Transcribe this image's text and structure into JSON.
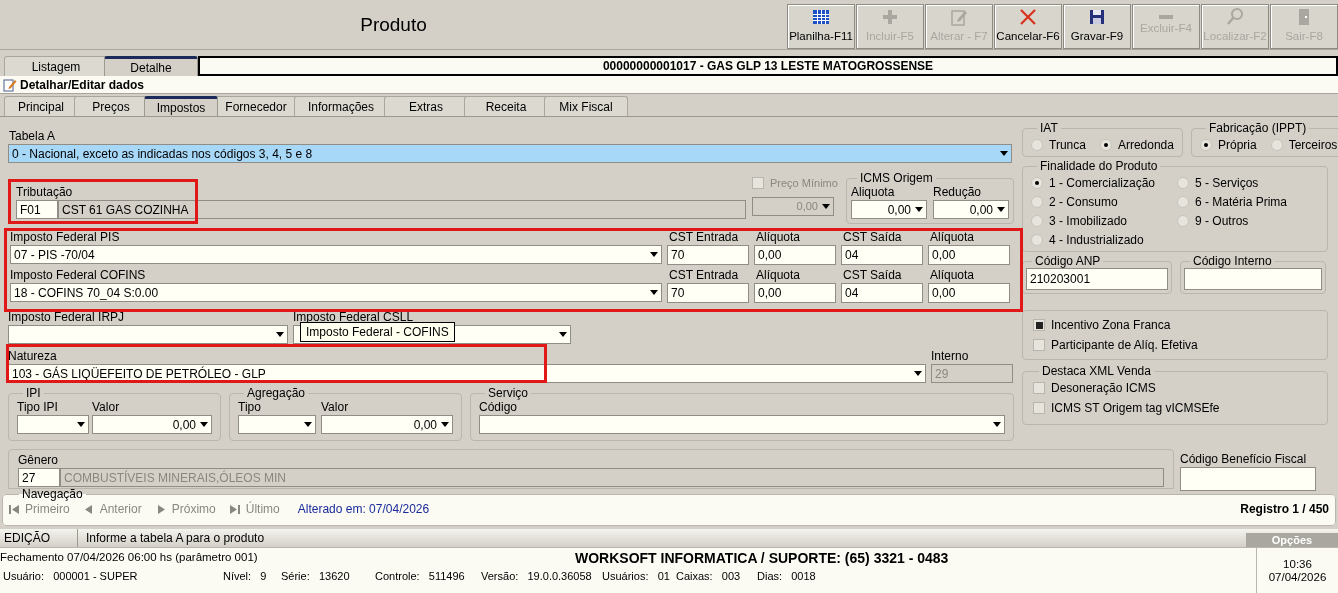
{
  "header": {
    "title": "Produto"
  },
  "toolbar": [
    {
      "label": "Planilha-F11",
      "kind": "grid",
      "disabled": false
    },
    {
      "label": "Incluir-F5",
      "kind": "plus",
      "disabled": true
    },
    {
      "label": "Alterar - F7",
      "kind": "edit",
      "disabled": true
    },
    {
      "label": "Cancelar-F6",
      "kind": "cross",
      "disabled": false
    },
    {
      "label": "Gravar-F9",
      "kind": "save",
      "disabled": false
    },
    {
      "label": "Excluir-F4",
      "kind": "minus",
      "disabled": true
    },
    {
      "label": "Localizar-F2",
      "kind": "search",
      "disabled": true
    },
    {
      "label": "Sair-F8",
      "kind": "exit",
      "disabled": true
    }
  ],
  "view_tabs": [
    {
      "label": "Listagem",
      "selected": false
    },
    {
      "label": "Detalhe",
      "selected": true
    }
  ],
  "record_title": "00000000001017 - GAS GLP 13 LESTE MATOGROSSENSE",
  "section_title": "Detalhar/Editar dados",
  "tabs": [
    {
      "label": "Principal",
      "selected": false
    },
    {
      "label": "Preços",
      "selected": false
    },
    {
      "label": "Impostos",
      "selected": true
    },
    {
      "label": "Fornecedor",
      "selected": false
    },
    {
      "label": "Informações",
      "selected": false
    },
    {
      "label": "Extras",
      "selected": false
    },
    {
      "label": "Receita",
      "selected": false
    },
    {
      "label": "Mix Fiscal",
      "selected": false
    }
  ],
  "form": {
    "tabela_a": {
      "label": "Tabela A",
      "value": "0 - Nacional, exceto as indicadas nos códigos 3, 4, 5 e 8"
    },
    "tributacao": {
      "label": "Tributação",
      "code": "F01",
      "description": "CST 61 GAS COZINHA"
    },
    "preco_minimo": {
      "label": "Preço Mínimo",
      "checked": false,
      "value": "0,00"
    },
    "icms_origem": {
      "title": "ICMS Origem",
      "aliquota_label": "Aliquota",
      "aliquota": "0,00",
      "reducao_label": "Redução",
      "reducao": "0,00"
    },
    "federal_taxes": [
      {
        "label": "Imposto Federal PIS",
        "value": "07 - PIS -70/04",
        "cst_entrada_label": "CST Entrada",
        "cst_entrada": "70",
        "aliquota_entrada_label": "Alíquota",
        "aliquota_entrada": "0,00",
        "cst_saida_label": "CST Saída",
        "cst_saida": "04",
        "aliquota_saida_label": "Alíquota",
        "aliquota_saida": "0,00"
      },
      {
        "label": "Imposto Federal COFINS",
        "value": "18 - COFINS 70_04 S:0.00",
        "cst_entrada_label": "CST Entrada",
        "cst_entrada": "70",
        "aliquota_entrada_label": "Alíquota",
        "aliquota_entrada": "0,00",
        "cst_saida_label": "CST Saída",
        "cst_saida": "04",
        "aliquota_saida_label": "Alíquota",
        "aliquota_saida": "0,00"
      }
    ],
    "irpj": {
      "label": "Imposto Federal IRPJ"
    },
    "csll": {
      "label": "Imposto Federal CSLL"
    },
    "tooltip": "Imposto Federal - COFINS",
    "natureza": {
      "label": "Natureza",
      "value": "103 - GÁS LIQÜEFEITO DE PETRÓLEO - GLP"
    },
    "interno": {
      "label": "Interno",
      "value": "29"
    },
    "ipi": {
      "title": "IPI",
      "tipo_label": "Tipo IPI",
      "valor_label": "Valor",
      "valor": "0,00"
    },
    "agregacao": {
      "title": "Agregação",
      "tipo_label": "Tipo",
      "valor_label": "Valor",
      "valor": "0,00"
    },
    "servico": {
      "title": "Serviço",
      "codigo_label": "Código"
    },
    "genero": {
      "label": "Gênero",
      "code": "27",
      "description": "COMBUSTÍVEIS MINERAIS,ÓLEOS MIN"
    },
    "codigo_beneficio": {
      "label": "Código Benefício Fiscal"
    },
    "iat": {
      "title": "IAT",
      "options": [
        {
          "label": "Trunca",
          "selected": false
        },
        {
          "label": "Arredonda",
          "selected": true
        }
      ]
    },
    "fabricacao": {
      "title": "Fabricação (IPPT)",
      "options": [
        {
          "label": "Própria",
          "selected": true
        },
        {
          "label": "Terceiros",
          "selected": false
        }
      ]
    },
    "finalidade": {
      "title": "Finalidade do Produto",
      "options": [
        {
          "label": "1 - Comercialização",
          "selected": true
        },
        {
          "label": "2 - Consumo",
          "selected": false
        },
        {
          "label": "3 - Imobilizado",
          "selected": false
        },
        {
          "label": "4 - Industrializado",
          "selected": false
        },
        {
          "label": "5 - Serviços",
          "selected": false
        },
        {
          "label": "6 - Matéria Prima",
          "selected": false
        },
        {
          "label": "9 - Outros",
          "selected": false
        }
      ]
    },
    "codigo_anp": {
      "label": "Código ANP",
      "value": "210203001"
    },
    "codigo_interno": {
      "label": "Código Interno"
    },
    "incentivos": [
      {
        "label": "Incentivo Zona Franca",
        "checked": true
      },
      {
        "label": "Participante de Alíq. Efetiva",
        "checked": false
      }
    ],
    "destaca_xml": {
      "title": "Destaca XML Venda",
      "options": [
        {
          "label": "Desoneração ICMS",
          "checked": false
        },
        {
          "label": "ICMS ST Origem tag vICMSEfe",
          "checked": false
        }
      ]
    }
  },
  "navigation": {
    "title": "Navegação",
    "buttons": [
      {
        "label": "Primeiro",
        "kind": "first",
        "disabled": true
      },
      {
        "label": "Anterior",
        "kind": "prev",
        "disabled": true
      },
      {
        "label": "Próximo",
        "kind": "next",
        "disabled": true
      },
      {
        "label": "Último",
        "kind": "last",
        "disabled": true
      }
    ],
    "changed": "Alterado em: 07/04/2026",
    "record": "Registro 1 / 450"
  },
  "status_bar": {
    "mode": "EDIÇÃO",
    "message": "Informe a tabela A para o produto",
    "options_button": "Opções"
  },
  "footer": {
    "closing": "Fechamento 07/04/2026 06:00 hs (parâmetro 001)",
    "support": "WORKSOFT INFORMATICA / SUPORTE: (65) 3321 - 0483",
    "info": [
      {
        "label": "Usuário:",
        "value": "000001 - SUPER"
      },
      {
        "label": "Nível:",
        "value": "9"
      },
      {
        "label": "Série:",
        "value": "13620"
      },
      {
        "label": "Controle:",
        "value": "511496"
      },
      {
        "label": "Versão:",
        "value": "19.0.0.36058"
      },
      {
        "label": "Usuários:",
        "value": "01"
      },
      {
        "label": "Caixas:",
        "value": "003"
      },
      {
        "label": "Dias:",
        "value": "0018"
      }
    ],
    "time": "10:36",
    "date": "07/04/2026"
  }
}
